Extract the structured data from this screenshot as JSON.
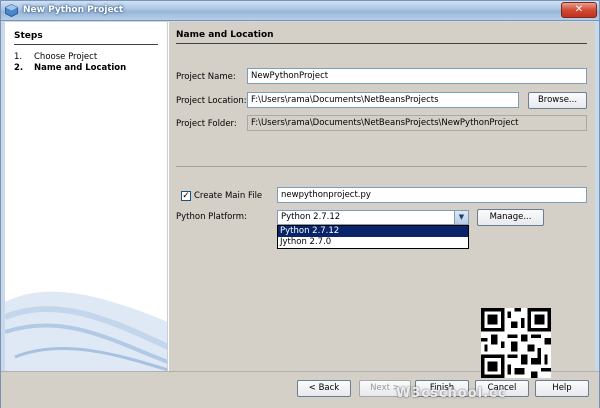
{
  "window": {
    "title": "New Python Project",
    "close_label": "✕"
  },
  "steps": {
    "title": "Steps",
    "items": [
      {
        "num": "1.",
        "label": "Choose Project"
      },
      {
        "num": "2.",
        "label": "Name and Location"
      }
    ]
  },
  "main": {
    "section_title": "Name and Location",
    "project_name": {
      "label": "Project Name:",
      "value": "NewPythonProject"
    },
    "project_location": {
      "label": "Project Location:",
      "value": "F:\\Users\\rama\\Documents\\NetBeansProjects",
      "browse_label": "Browse..."
    },
    "project_folder": {
      "label": "Project Folder:",
      "value": "F:\\Users\\rama\\Documents\\NetBeansProjects\\NewPythonProject"
    },
    "create_main_file": {
      "label": "Create Main File",
      "checked": true,
      "value": "newpythonproject.py"
    },
    "python_platform": {
      "label": "Python Platform:",
      "selected": "Python 2.7.12",
      "options": [
        "Python 2.7.12",
        "Jython 2.7.0"
      ],
      "manage_label": "Manage..."
    }
  },
  "buttons": {
    "back": "< Back",
    "next": "Next >",
    "finish": "Finish",
    "cancel": "Cancel",
    "help": "Help"
  },
  "watermark": "W3cschool.cc"
}
